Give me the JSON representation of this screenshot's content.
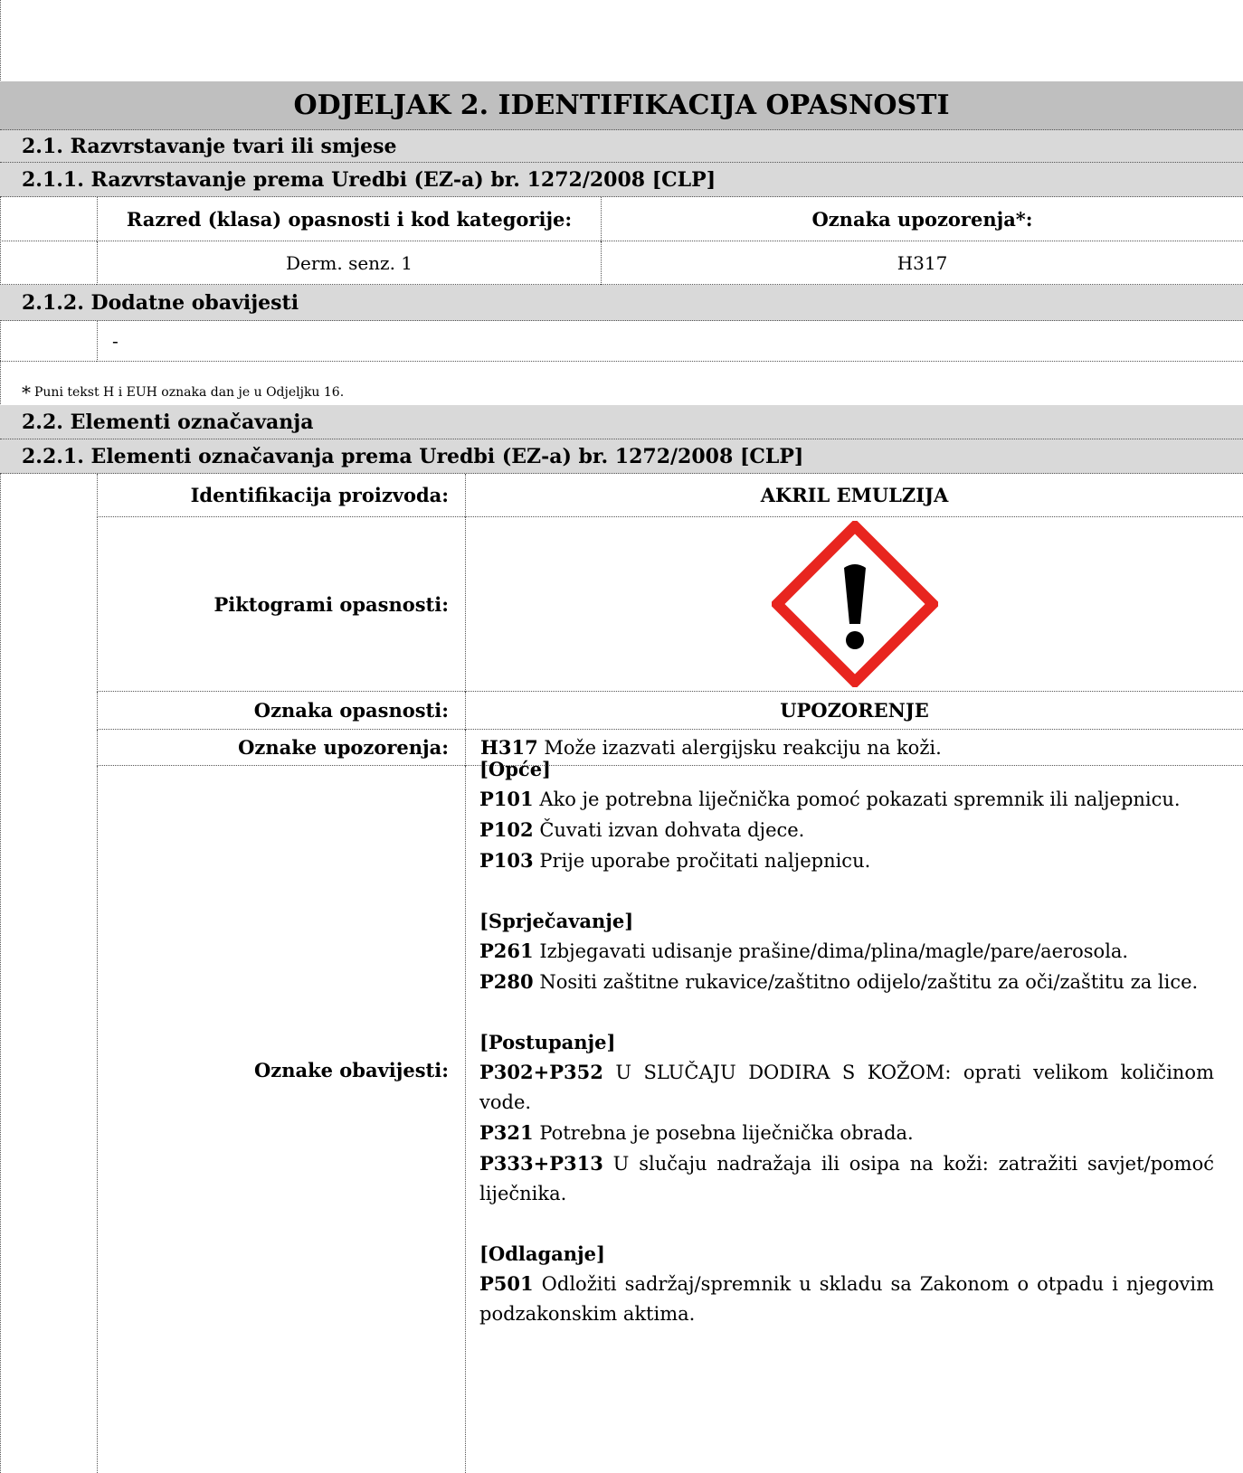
{
  "section_title": "ODJELJAK 2. IDENTIFIKACIJA OPASNOSTI",
  "s2_1": "2.1. Razvrstavanje tvari ili smjese",
  "s2_1_1": "2.1.1. Razvrstavanje prema Uredbi (EZ-a) br. 1272/2008 [CLP]",
  "classification": {
    "col1_header": "Razred (klasa) opasnosti i kod kategorije:",
    "col2_header": "Oznaka upozorenja*:",
    "col1_value": "Derm. senz. 1",
    "col2_value": "H317"
  },
  "s2_1_2": "2.1.2. Dodatne obavijesti",
  "additional_info": "-",
  "footnote_star": "*",
  "footnote": "Puni tekst H i EUH oznaka dan je u Odjeljku 16.",
  "s2_2": "2.2. Elementi označavanja",
  "s2_2_1": "2.2.1. Elementi označavanja prema Uredbi (EZ-a) br. 1272/2008 [CLP]",
  "labels": {
    "product_id_label": "Identifikacija proizvoda:",
    "product_id_value": "AKRIL EMULZIJA",
    "pictogram_label": "Piktogrami opasnosti:",
    "signal_label": "Oznaka opasnosti:",
    "signal_value": "UPOZORENJE",
    "hazard_label": "Oznake upozorenja:",
    "hazard_code": "H317",
    "hazard_text": " Može izazvati alergijsku reakciju na koži.",
    "precaution_label": "Oznake obavijesti:"
  },
  "pictogram": {
    "icon": "ghs07-exclamation-icon",
    "border_color": "#e8251f"
  },
  "precautions": [
    {
      "heading": "[Opće]",
      "items": [
        {
          "code": "P101",
          "text": " Ako je potrebna liječnička pomoć pokazati spremnik ili naljepnicu."
        },
        {
          "code": "P102",
          "text": " Čuvati izvan dohvata djece."
        },
        {
          "code": "P103",
          "text": " Prije uporabe pročitati naljepnicu."
        }
      ]
    },
    {
      "heading": "[Sprječavanje]",
      "items": [
        {
          "code": "P261",
          "text": " Izbjegavati udisanje prašine/dima/plina/magle/pare/aerosola."
        },
        {
          "code": "P280",
          "text": " Nositi zaštitne rukavice/zaštitno odijelo/zaštitu za oči/zaštitu za lice."
        }
      ]
    },
    {
      "heading": "[Postupanje]",
      "items": [
        {
          "code": "P302+P352",
          "text": " U SLUČAJU DODIRA S KOŽOM: oprati velikom količinom vode."
        },
        {
          "code": "P321",
          "text": " Potrebna je posebna liječnička obrada."
        },
        {
          "code": "P333+P313",
          "text": " U slučaju nadražaja ili osipa na koži: zatražiti savjet/pomoć liječnika."
        }
      ]
    },
    {
      "heading": "[Odlaganje]",
      "items": [
        {
          "code": "P501",
          "text": " Odložiti sadržaj/spremnik u skladu sa Zakonom o otpadu i njegovim podzakonskim aktima."
        }
      ]
    }
  ]
}
